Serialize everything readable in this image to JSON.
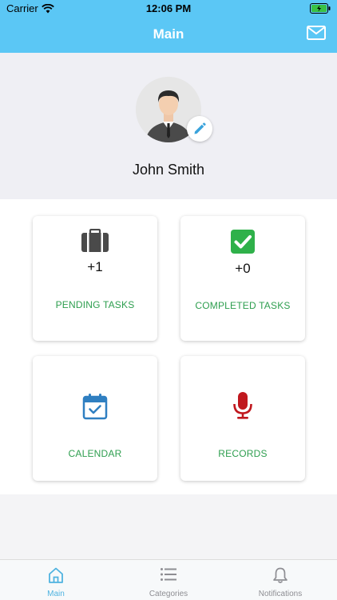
{
  "status_bar": {
    "carrier": "Carrier",
    "time": "12:06 PM"
  },
  "header": {
    "title": "Main"
  },
  "profile": {
    "name": "John Smith"
  },
  "cards": [
    {
      "count": "+1",
      "label": "PENDING TASKS",
      "icon": "briefcase-icon"
    },
    {
      "count": "+0",
      "label": "COMPLETED TASKS",
      "icon": "checkbox-icon"
    },
    {
      "label": "CALENDAR",
      "icon": "calendar-icon"
    },
    {
      "label": "RECORDS",
      "icon": "microphone-icon"
    }
  ],
  "tabbar": {
    "tabs": [
      {
        "label": "Main",
        "icon": "home-icon",
        "active": true
      },
      {
        "label": "Categories",
        "icon": "list-icon",
        "active": false
      },
      {
        "label": "Notifications",
        "icon": "bell-icon",
        "active": false
      }
    ]
  },
  "colors": {
    "header_bg": "#5bc7f5",
    "accent_green": "#2e9e4f",
    "calendar_blue": "#2f7fc1",
    "mic_red": "#c0181e",
    "active_tab": "#4fb3e0"
  }
}
